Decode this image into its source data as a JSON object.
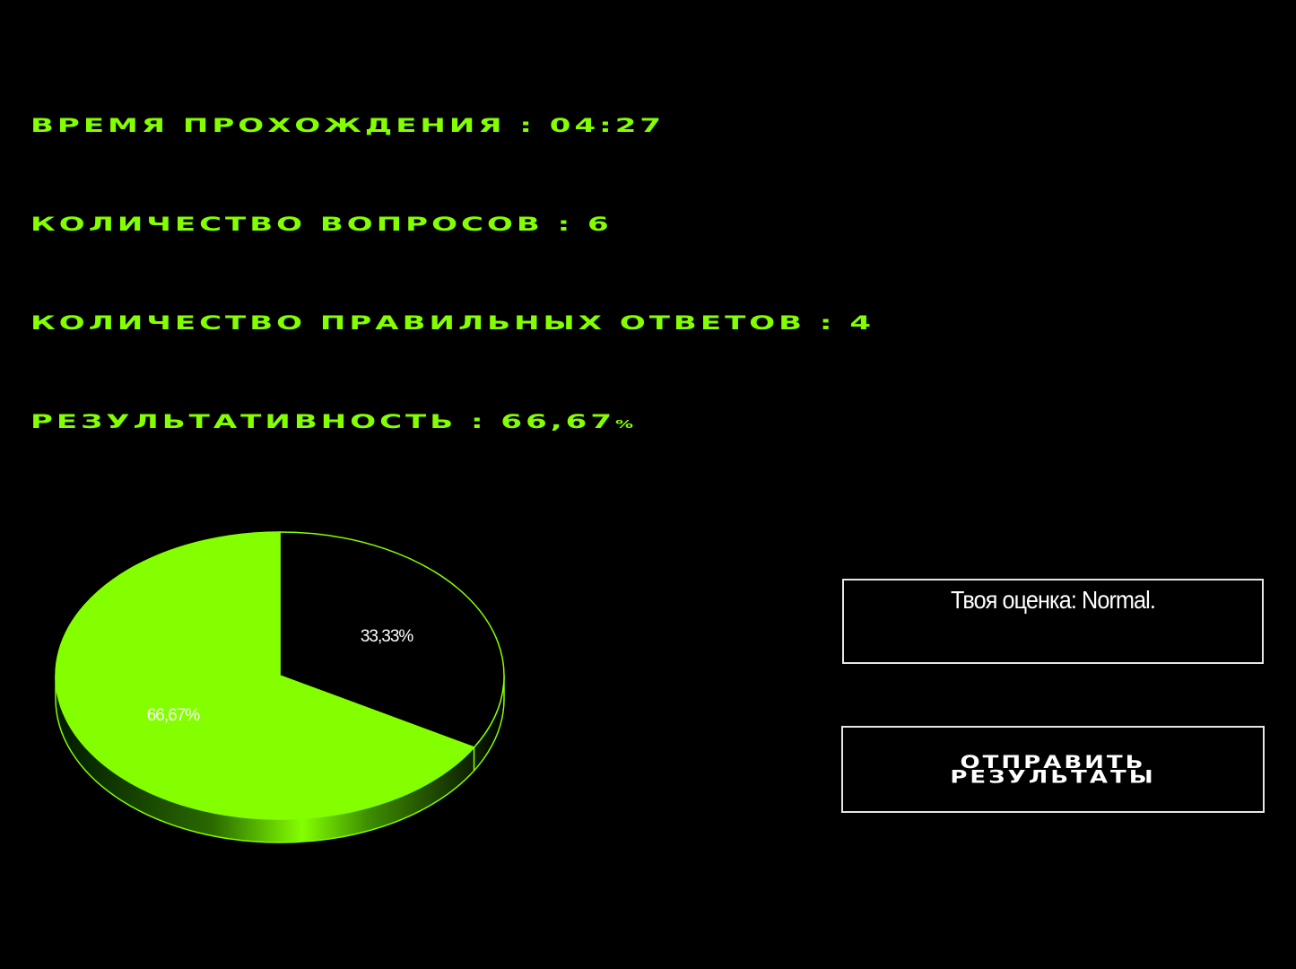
{
  "stats": {
    "time_label": "ВРЕМЯ ПРОХОЖДЕНИЯ : 04:27",
    "questions_label": "КОЛИЧЕСТВО ВОПРОСОВ : 6",
    "correct_label": "КОЛИЧЕСТВО ПРАВИЛЬНЫХ ОТВЕТОВ : 4",
    "result_label": "РЕЗУЛЬТАТИВНОСТЬ : 66,67",
    "result_percent_sign": "%"
  },
  "grade": {
    "text": "Твоя оценка: Normal."
  },
  "submit": {
    "label": "ОТПРАВИТЬ РЕЗУЛЬТАТЫ"
  },
  "colors": {
    "accent": "#84ff00",
    "background": "#000000",
    "border": "#e6e6e6",
    "text_white": "#ffffff"
  },
  "chart_data": {
    "type": "pie",
    "values": [
      33.33,
      66.67
    ],
    "labels": [
      "33,33%",
      "66,67%"
    ],
    "slice_colors": [
      "#000000",
      "#84ff00"
    ],
    "style": "3d"
  }
}
